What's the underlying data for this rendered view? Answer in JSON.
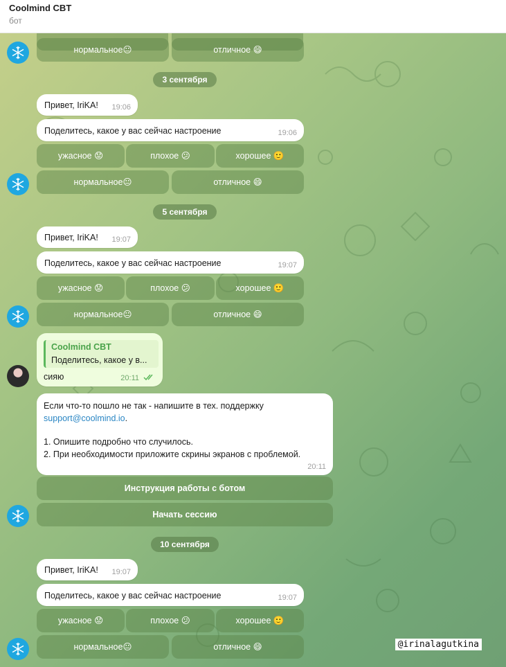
{
  "header": {
    "title": "Coolmind CBT",
    "subtitle": "бот"
  },
  "moods": {
    "row1": [
      "ужасное 😟",
      "плохое 😕",
      "хорошее 🙂"
    ],
    "row2": [
      "нормальное😐",
      "отличное 😄"
    ]
  },
  "dates": [
    "3 сентября",
    "5 сентября",
    "10 сентября"
  ],
  "greeting": "Привет,  IriKA!",
  "question": "Поделитесь, какое у вас сейчас настроение",
  "times": {
    "t1": "19:06",
    "t2": "19:06",
    "t3": "19:07",
    "t4": "19:07",
    "t5": "20:11",
    "t6": "20:11",
    "t7": "19:07",
    "t8": "19:07"
  },
  "reply": {
    "quote_name": "Coolmind CBT",
    "quote_text": "Поделитесь, какое у в...",
    "text": "сияю",
    "status_icon": "double-check-icon"
  },
  "support": {
    "line1": "Если что-то пошло не так - напишите в тех. поддержку",
    "email": "support@coolmind.io",
    "dot": ".",
    "item1": "1. Опишите подробно что случилось.",
    "item2": "2. При необходимости приложите скрины экранов с проблемой."
  },
  "buttons": {
    "instructions": "Инструкция работы с ботом",
    "start": "Начать сессию"
  },
  "watermark": "@irinalagutkina",
  "colors": {
    "accent": "#5cb85c",
    "link": "#2a86c4",
    "avatar": "#1fa7e0"
  }
}
